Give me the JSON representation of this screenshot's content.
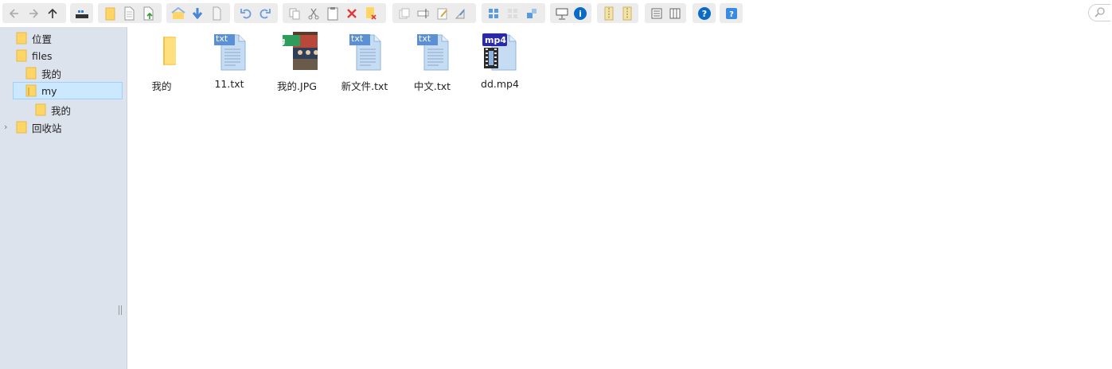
{
  "toolbar": {
    "icons": [
      "back-icon",
      "forward-icon",
      "up-icon",
      "address-bar-icon",
      "new-folder-icon",
      "new-file-icon",
      "upload-icon",
      "home-icon",
      "download-icon",
      "paste-doc-icon",
      "undo-icon",
      "redo-icon",
      "copy-icon",
      "cut-icon",
      "paste-icon",
      "delete-icon",
      "empty-trash-icon",
      "duplicate-icon",
      "rename-icon",
      "edit-icon",
      "resize-icon",
      "icons-view-icon",
      "grid-view-icon",
      "list-view-icon",
      "preview-icon",
      "info-icon",
      "extract-icon",
      "archive-icon",
      "details-view-icon",
      "columns-view-icon",
      "help-icon",
      "about-icon",
      "search-icon"
    ]
  },
  "sidebar": {
    "items": [
      {
        "label": "位置"
      },
      {
        "label": "files"
      },
      {
        "label": "我的"
      },
      {
        "label": "my"
      },
      {
        "label": "我的"
      },
      {
        "label": "回收站"
      }
    ]
  },
  "files": [
    {
      "name": "我的",
      "type": "folder"
    },
    {
      "name": "11.txt",
      "type": "txt",
      "badge": "txt"
    },
    {
      "name": "我的.JPG",
      "type": "jpg",
      "badge": "jpg"
    },
    {
      "name": "新文件.txt",
      "type": "txt",
      "badge": "txt"
    },
    {
      "name": "中文.txt",
      "type": "txt",
      "badge": "txt"
    },
    {
      "name": "dd.mp4",
      "type": "mp4",
      "badge": "mp4"
    }
  ],
  "colors": {
    "folder": "#ffd666",
    "txt_badge": "#5b8fd6",
    "jpg_badge": "#2e9d5b",
    "mp4_badge": "#2a2aa6",
    "selection": "#cce8ff"
  }
}
